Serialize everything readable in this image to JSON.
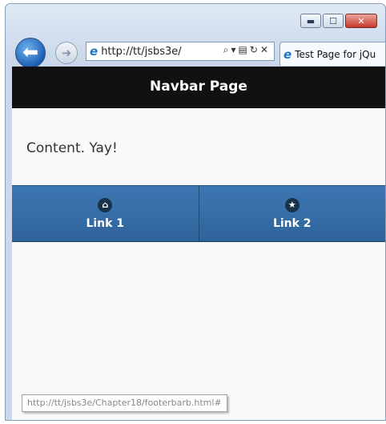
{
  "browser": {
    "address": "http://tt/jsbs3e/",
    "tab_title": "Test Page for jQu",
    "status_url": "http://tt/jsbs3e/Chapter18/footerbarb.html#"
  },
  "page": {
    "header": "Navbar Page",
    "content": "Content. Yay!",
    "navbar": [
      {
        "label": "Link 1",
        "icon": "home-icon"
      },
      {
        "label": "Link 2",
        "icon": "star-icon"
      }
    ]
  },
  "colors": {
    "header_bg": "#111111",
    "navbar_bg": "#356ba1"
  }
}
